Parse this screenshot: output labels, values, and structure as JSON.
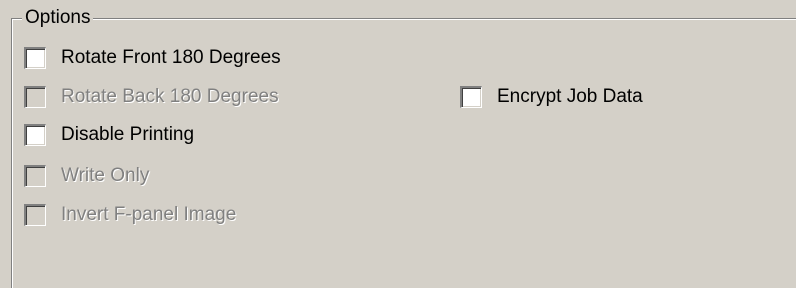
{
  "options_group": {
    "title": "Options",
    "items": [
      {
        "label": "Rotate Front 180 Degrees",
        "checked": false,
        "enabled": true
      },
      {
        "label": "Rotate Back 180 Degrees",
        "checked": false,
        "enabled": false
      },
      {
        "label": "Disable Printing",
        "checked": false,
        "enabled": true
      },
      {
        "label": "Write Only",
        "checked": false,
        "enabled": false
      },
      {
        "label": "Invert F-panel Image",
        "checked": false,
        "enabled": false
      },
      {
        "label": "Encrypt Job Data",
        "checked": false,
        "enabled": true
      }
    ]
  }
}
